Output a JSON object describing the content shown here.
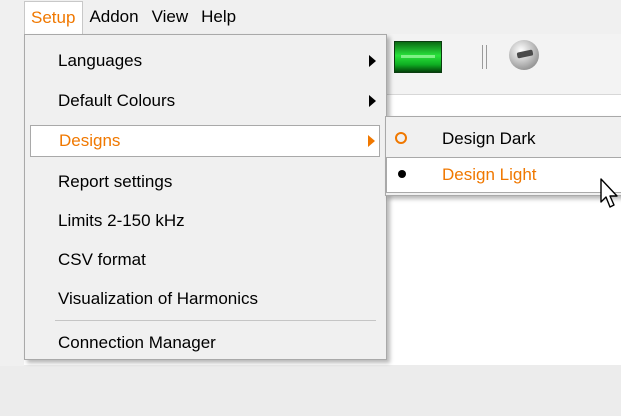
{
  "menubar": {
    "items": [
      {
        "label": "Setup",
        "open": true
      },
      {
        "label": "Addon"
      },
      {
        "label": "View"
      },
      {
        "label": "Help"
      }
    ]
  },
  "setup_menu": {
    "items": [
      {
        "label": "Languages",
        "has_submenu": true
      },
      {
        "label": "Default Colours",
        "has_submenu": true
      },
      {
        "label": "Designs",
        "has_submenu": true,
        "highlighted": true
      },
      {
        "label": "Report settings"
      },
      {
        "label": "Limits 2-150 kHz"
      },
      {
        "label": "CSV format"
      },
      {
        "label": "Visualization of Harmonics"
      },
      {
        "label": "Connection Manager"
      }
    ]
  },
  "designs_submenu": {
    "items": [
      {
        "label": "Design Dark",
        "checked": false
      },
      {
        "label": "Design Light",
        "checked": true,
        "highlighted": true
      }
    ]
  },
  "colors": {
    "accent": "#f07800",
    "menu_bg": "#f0f0f0",
    "highlight_bg": "#ffffff"
  },
  "icons": [
    "green-display-icon",
    "separator-icon",
    "globe-icon",
    "submenu-arrow-icon",
    "radio-icon",
    "mouse-pointer-icon"
  ]
}
